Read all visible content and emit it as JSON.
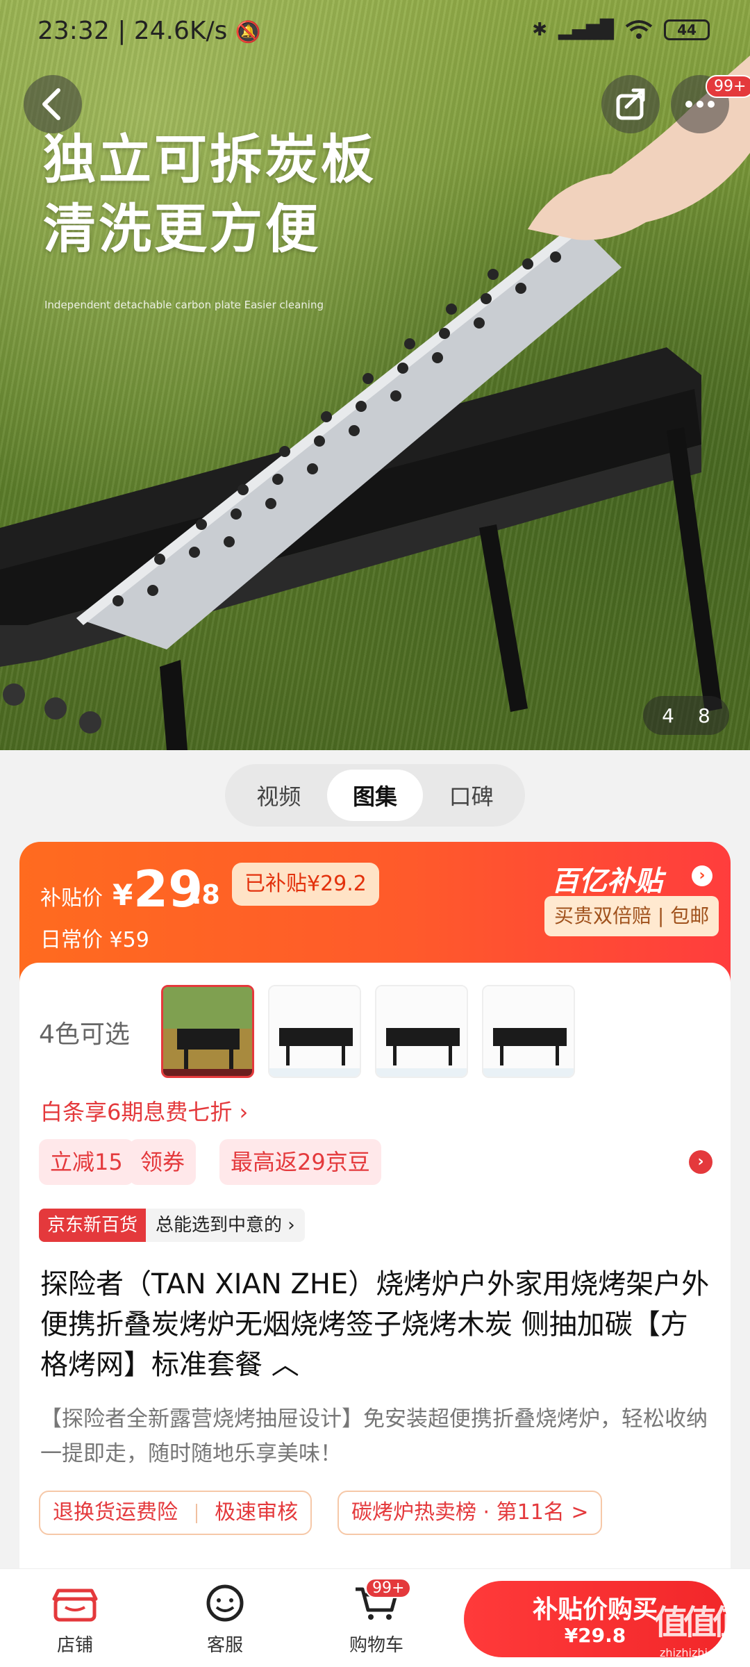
{
  "status_bar": {
    "time": "23:32",
    "speed": "24.6K/s",
    "battery": "44"
  },
  "hero": {
    "headline_1": "独立可拆炭板",
    "headline_2": "清洗更方便",
    "caption": "Independent detachable carbon plate Easier cleaning",
    "current_page": "4",
    "total_pages": "8",
    "more_badge": "99+"
  },
  "tabs": [
    "视频",
    "图集",
    "口碑"
  ],
  "price": {
    "label": "补贴价",
    "yen": "¥",
    "integer": "29",
    "decimal": ".8",
    "subsidized": "已补贴¥29.2",
    "daily_label": "日常价",
    "daily_value": "¥59",
    "program": "百亿补贴",
    "program_sub": "买贵双倍赔 | 包邮"
  },
  "options": {
    "label": "4色可选"
  },
  "baitiao": "白条享6期息费七折 ›",
  "coupons": {
    "reduce": "立减15",
    "get": "领券",
    "beans": "最高返29京豆"
  },
  "jd_tag": {
    "name": "京东新百货",
    "slogan": "总能选到中意的 ›"
  },
  "product": {
    "title": "探险者（TAN XIAN ZHE）烧烤炉户外家用烧烤架户外便携折叠炭烤炉无烟烧烤签子烧烤木炭 侧抽加碳【方格烤网】标准套餐 ︿",
    "desc": "【探险者全新露营烧烤抽屉设计】免安装超便携折叠烧烤炉，轻松收纳一提即走，随时随地乐享美味！"
  },
  "pills": {
    "service_a": "退换货运费险",
    "service_b": "极速审核",
    "rank": "碳烤炉热卖榜 · 第11名 >"
  },
  "bottom_nav": {
    "shop": "店铺",
    "service": "客服",
    "cart": "购物车",
    "cart_badge": "99+",
    "buy_main": "补贴价购买",
    "buy_sub": "¥29.8",
    "watermark": "值值值",
    "watermark_url": "zhizhizhi.com"
  },
  "colors": {
    "accent": "#e4393c",
    "orange": "#ff6b1f",
    "program_bg": "#ffe9d0"
  }
}
